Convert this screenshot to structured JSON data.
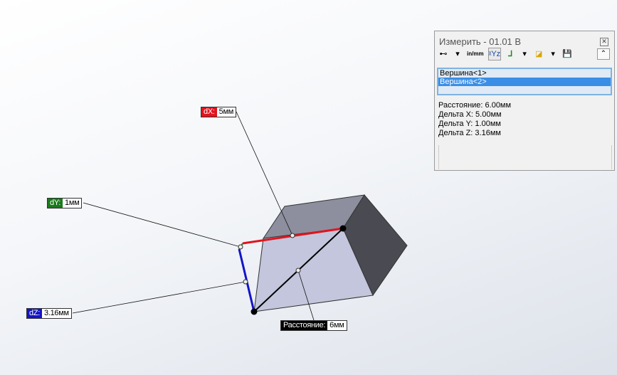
{
  "panel": {
    "title": "Измерить - 01.01 В",
    "close_icon": "close-icon",
    "toolbar": [
      {
        "icon": "arc-condition-icon",
        "glyph": "⊷"
      },
      {
        "icon": "dropdown-arrow-icon",
        "glyph": "▾"
      },
      {
        "icon": "units-in-mm-icon",
        "glyph": "in/mm"
      },
      {
        "icon": "show-xyz-icon",
        "glyph": "ᵡYz"
      },
      {
        "icon": "coordinate-system-icon",
        "glyph": "⅃"
      },
      {
        "icon": "dropdown-arrow-icon",
        "glyph": "▾"
      },
      {
        "icon": "projection-icon",
        "glyph": "◪"
      },
      {
        "icon": "dropdown-arrow-icon",
        "glyph": "▾"
      },
      {
        "icon": "save-icon",
        "glyph": "💾"
      }
    ],
    "selections": [
      {
        "label": "Вершина<1>",
        "selected": false
      },
      {
        "label": "Вершина<2>",
        "selected": true
      }
    ],
    "results": [
      "Расстояние: 6.00мм",
      "Дельта X: 5.00мм",
      "Дельта Y: 1.00мм",
      "Дельта Z: 3.16мм"
    ]
  },
  "callouts": {
    "dx": {
      "key": "dX:",
      "value": "5мм",
      "color": "#e0141e"
    },
    "dy": {
      "key": "dY:",
      "value": "1мм",
      "color": "#1a7a1a"
    },
    "dz": {
      "key": "dZ:",
      "value": "3.16мм",
      "color": "#1414c8"
    },
    "distance": {
      "key": "Расстояние:",
      "value": "6мм",
      "color": "#000000"
    }
  }
}
